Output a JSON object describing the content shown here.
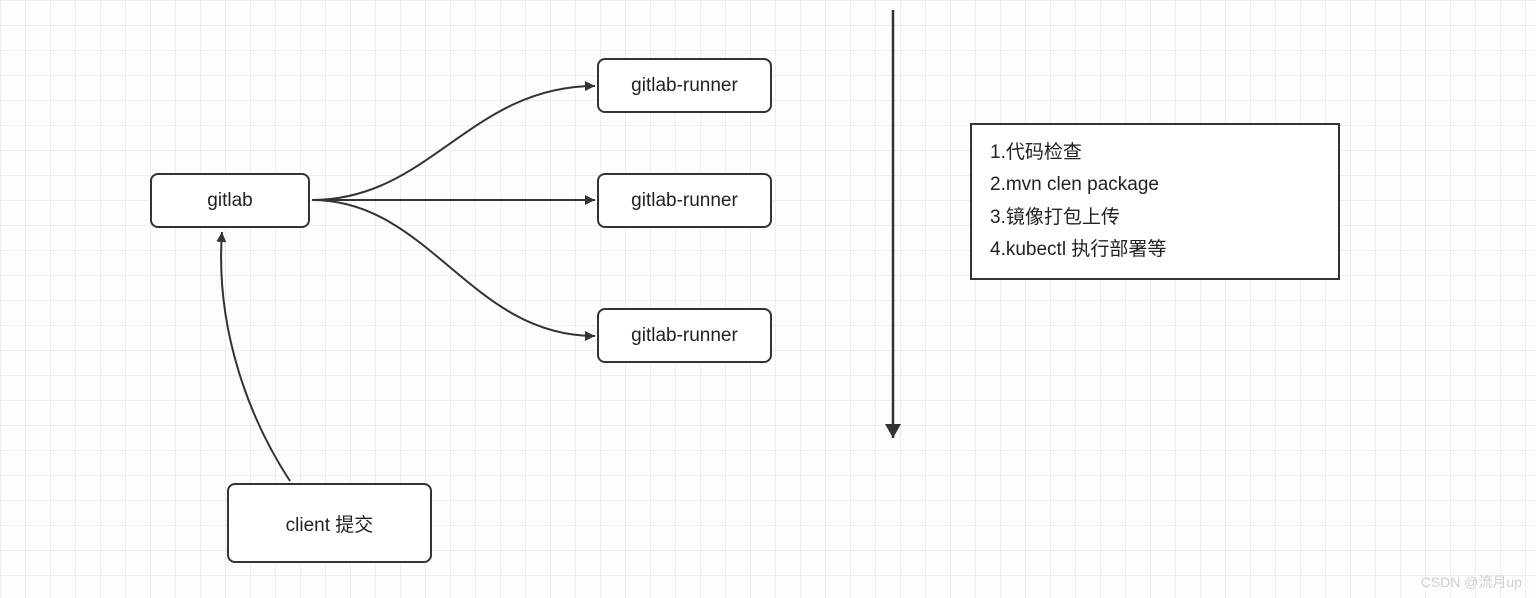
{
  "nodes": {
    "gitlab": "gitlab",
    "runner1": "gitlab-runner",
    "runner2": "gitlab-runner",
    "runner3": "gitlab-runner",
    "client": "client 提交"
  },
  "steps": {
    "line1": "1.代码检查",
    "line2": "2.mvn clen package",
    "line3": "3.镜像打包上传",
    "line4": "4.kubectl 执行部署等"
  },
  "watermark": "CSDN @流月up"
}
